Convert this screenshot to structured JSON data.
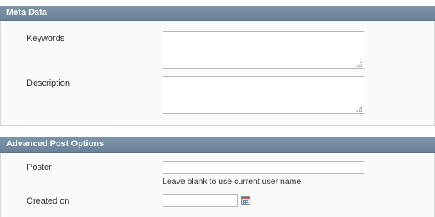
{
  "meta_data": {
    "header": "Meta Data",
    "keywords_label": "Keywords",
    "description_label": "Description",
    "keywords_value": "",
    "description_value": ""
  },
  "advanced": {
    "header": "Advanced Post Options",
    "poster_label": "Poster",
    "poster_value": "",
    "poster_note": "Leave blank to use current user name",
    "created_label": "Created on",
    "created_value": "",
    "calendar_icon": "calendar-icon"
  },
  "colors": {
    "section_header": "#6a8399",
    "panel_bg": "#fafafa",
    "field_border": "#b8b8b8"
  }
}
